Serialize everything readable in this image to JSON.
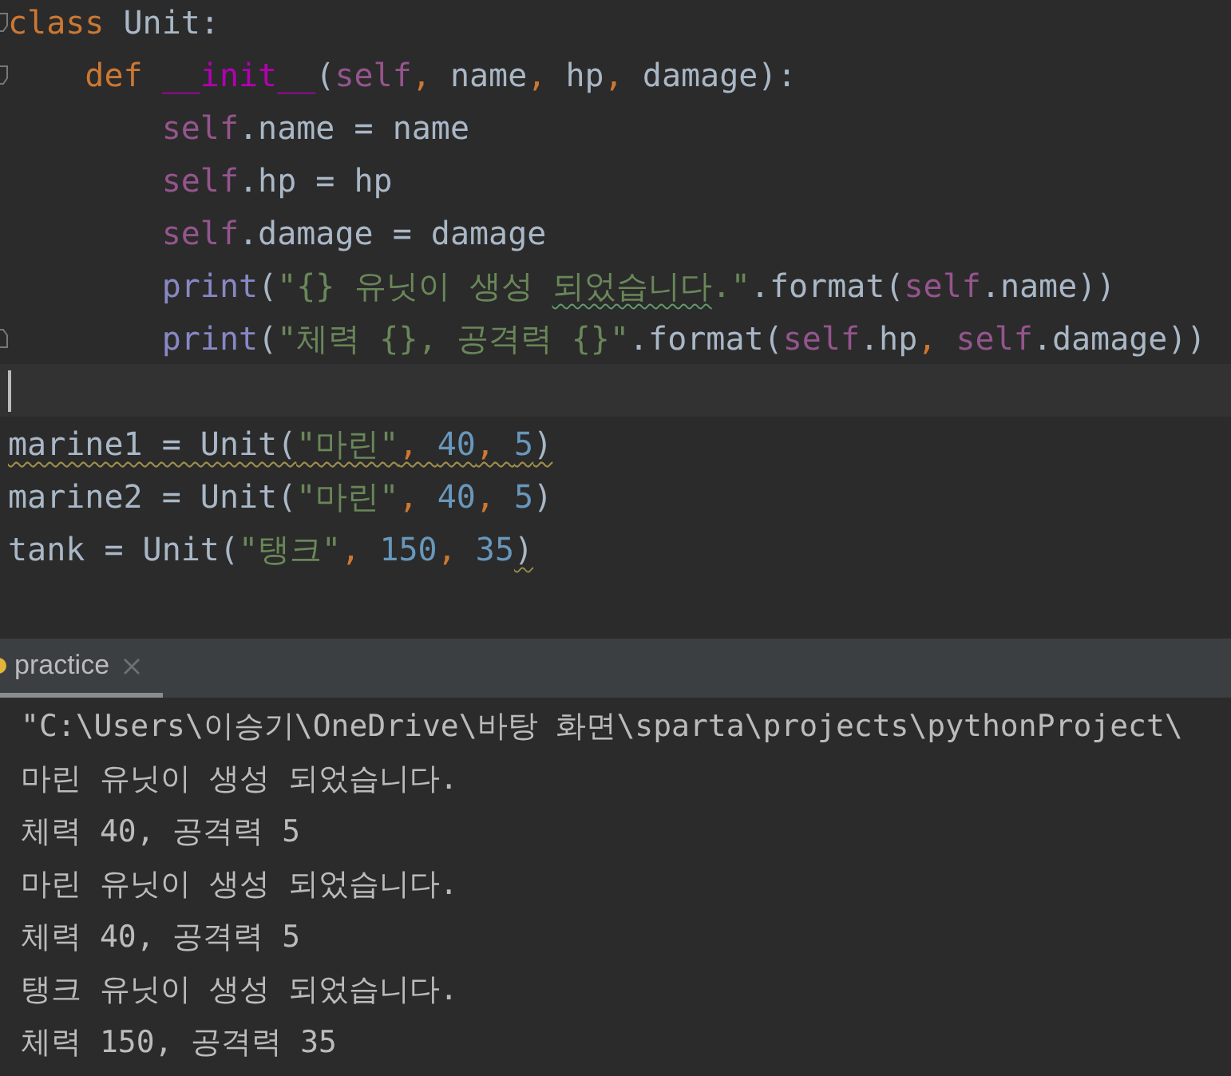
{
  "editor": {
    "lines": [
      {
        "fold_start": true,
        "tokens": [
          {
            "kind": "keyword",
            "t": "class "
          },
          {
            "kind": "plain",
            "t": "Unit:"
          }
        ]
      },
      {
        "fold_start": true,
        "tokens": [
          {
            "kind": "keyword",
            "t": "    def "
          },
          {
            "kind": "magic",
            "t": "__init__"
          },
          {
            "kind": "plain",
            "t": "("
          },
          {
            "kind": "self",
            "t": "self"
          },
          {
            "kind": "comma",
            "t": ", "
          },
          {
            "kind": "plain",
            "t": "name"
          },
          {
            "kind": "comma",
            "t": ", "
          },
          {
            "kind": "plain",
            "t": "hp"
          },
          {
            "kind": "comma",
            "t": ", "
          },
          {
            "kind": "plain",
            "t": "damage):"
          }
        ]
      },
      {
        "tokens": [
          {
            "kind": "self",
            "t": "        self"
          },
          {
            "kind": "plain",
            "t": ".name = name"
          }
        ]
      },
      {
        "tokens": [
          {
            "kind": "self",
            "t": "        self"
          },
          {
            "kind": "plain",
            "t": ".hp = hp"
          }
        ]
      },
      {
        "tokens": [
          {
            "kind": "self",
            "t": "        self"
          },
          {
            "kind": "plain",
            "t": ".damage = damage"
          }
        ]
      },
      {
        "tokens": [
          {
            "kind": "builtin",
            "t": "        print"
          },
          {
            "kind": "plain",
            "t": "("
          },
          {
            "kind": "string",
            "t": "\"{} 유닛이 생성 "
          },
          {
            "kind": "string",
            "t": "되었습니다",
            "typo": true
          },
          {
            "kind": "string",
            "t": ".\""
          },
          {
            "kind": "plain",
            "t": ".format("
          },
          {
            "kind": "self",
            "t": "self"
          },
          {
            "kind": "plain",
            "t": ".name))"
          }
        ]
      },
      {
        "fold_end": true,
        "tokens": [
          {
            "kind": "builtin",
            "t": "        print"
          },
          {
            "kind": "plain",
            "t": "("
          },
          {
            "kind": "string",
            "t": "\"체력 {}, 공격력 {}\""
          },
          {
            "kind": "plain",
            "t": ".format("
          },
          {
            "kind": "self",
            "t": "self"
          },
          {
            "kind": "plain",
            "t": ".hp"
          },
          {
            "kind": "comma",
            "t": ", "
          },
          {
            "kind": "self",
            "t": "self"
          },
          {
            "kind": "plain",
            "t": ".damage))"
          }
        ]
      },
      {
        "current": true,
        "caret": true
      },
      {
        "warning": true,
        "tokens": [
          {
            "kind": "plain",
            "t": "marine1 = Unit("
          },
          {
            "kind": "string",
            "t": "\"마린\""
          },
          {
            "kind": "comma",
            "t": ", "
          },
          {
            "kind": "number",
            "t": "40"
          },
          {
            "kind": "comma",
            "t": ", "
          },
          {
            "kind": "number",
            "t": "5"
          },
          {
            "kind": "plain",
            "t": ")"
          }
        ]
      },
      {
        "tokens": [
          {
            "kind": "plain",
            "t": "marine2 = Unit("
          },
          {
            "kind": "string",
            "t": "\"마린\""
          },
          {
            "kind": "comma",
            "t": ", "
          },
          {
            "kind": "number",
            "t": "40"
          },
          {
            "kind": "comma",
            "t": ", "
          },
          {
            "kind": "number",
            "t": "5"
          },
          {
            "kind": "plain",
            "t": ")"
          }
        ]
      },
      {
        "tokens": [
          {
            "kind": "plain",
            "t": "tank = Unit("
          },
          {
            "kind": "string",
            "t": "\"탱크\""
          },
          {
            "kind": "comma",
            "t": ", "
          },
          {
            "kind": "number",
            "t": "150"
          },
          {
            "kind": "comma",
            "t": ", "
          },
          {
            "kind": "number",
            "t": "35"
          },
          {
            "kind": "plain",
            "t": ")",
            "warning": true
          }
        ]
      }
    ]
  },
  "run_panel": {
    "tabs": [
      {
        "label": "practice",
        "selected": true
      }
    ],
    "output": [
      "\"C:\\Users\\이승기\\OneDrive\\바탕 화면\\sparta\\projects\\pythonProject\\",
      "마린 유닛이 생성 되었습니다.",
      "체력 40, 공격력 5",
      "마린 유닛이 생성 되었습니다.",
      "체력 40, 공격력 5",
      "탱크 유닛이 생성 되었습니다.",
      "체력 150, 공격력 35"
    ]
  }
}
